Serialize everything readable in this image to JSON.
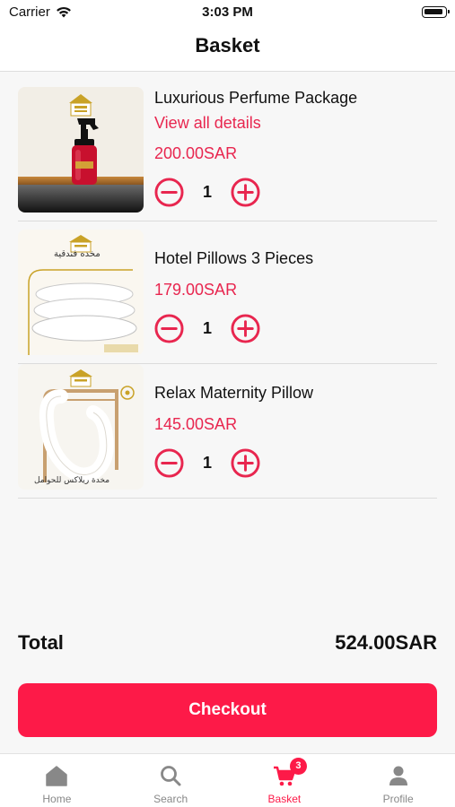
{
  "status_bar": {
    "carrier": "Carrier",
    "time": "3:03 PM"
  },
  "header": {
    "title": "Basket"
  },
  "basket_items": [
    {
      "name": "Luxurious Perfume Package",
      "details_link": "View all details",
      "price": "200.00SAR",
      "quantity": "1",
      "image_caption": ""
    },
    {
      "name": "Hotel Pillows 3 Pieces",
      "price": "179.00SAR",
      "quantity": "1",
      "image_caption": "مخده فندقية"
    },
    {
      "name": "Relax Maternity Pillow",
      "price": "145.00SAR",
      "quantity": "1",
      "image_caption": "مخدة ريلاكس للحوامل"
    }
  ],
  "summary": {
    "total_label": "Total",
    "total_value": "524.00SAR"
  },
  "checkout_label": "Checkout",
  "tab_bar": {
    "items": [
      {
        "label": "Home",
        "icon": "home-icon"
      },
      {
        "label": "Search",
        "icon": "search-icon"
      },
      {
        "label": "Basket",
        "icon": "cart-icon",
        "badge": "3",
        "active": true
      },
      {
        "label": "Profile",
        "icon": "person-icon"
      }
    ]
  },
  "colors": {
    "accent": "#fd1a48",
    "price": "#e8264f",
    "inactive_tab": "#888888",
    "background": "#f7f7f7"
  }
}
